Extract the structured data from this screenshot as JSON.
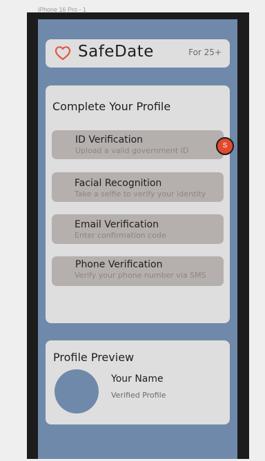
{
  "frame": {
    "label": "iPhone 16 Pro - 1"
  },
  "header": {
    "icon": "heart-icon",
    "title": "SafeDate",
    "age_label": "For 25+"
  },
  "verification": {
    "title": "Complete Your Profile",
    "items": [
      {
        "title": "ID Verification",
        "subtitle": "Upload a valid government ID"
      },
      {
        "title": "Facial Recognition",
        "subtitle": "Take a selfie to verify your identity"
      },
      {
        "title": "Email Verification",
        "subtitle": "Enter confirmation code"
      },
      {
        "title": "Phone Verification",
        "subtitle": "Verify your phone number via SMS"
      }
    ]
  },
  "user_badge": {
    "initial": "S"
  },
  "preview": {
    "title": "Profile Preview",
    "name": "Your Name",
    "status": "Verified Profile"
  },
  "colors": {
    "screen_background": "#6f89ab",
    "card": "#dedede",
    "item": "#b5afad",
    "heart": "#e4573f",
    "badge": "#e04a2f"
  }
}
